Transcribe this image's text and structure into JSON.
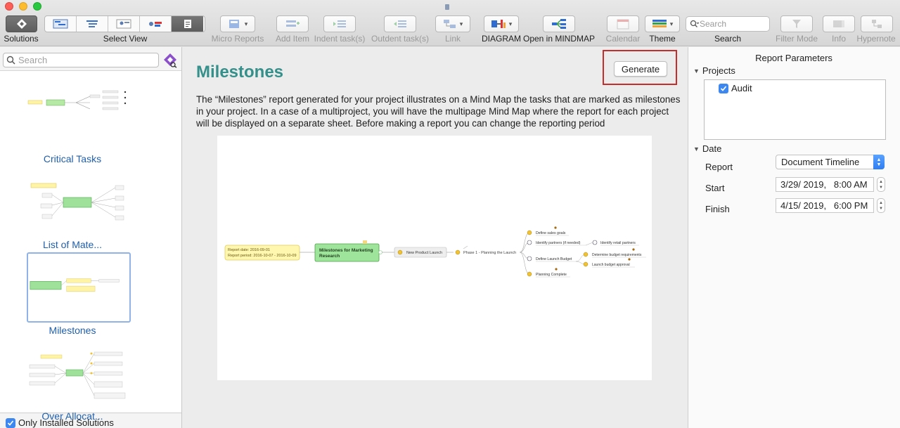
{
  "toolbar": {
    "solutions_label": "Solutions",
    "select_view_label": "Select View",
    "micro_reports_label": "Micro Reports",
    "add_item_label": "Add Item",
    "indent_label": "Indent task(s)",
    "outdent_label": "Outdent task(s)",
    "link_label": "Link",
    "diagram_label": "DIAGRAM",
    "open_mindmap_label": "Open in MINDMAP",
    "calendar_label": "Calendar",
    "theme_label": "Theme",
    "search_placeholder": "Search",
    "search_label": "Search",
    "filter_label": "Filter Mode",
    "info_label": "Info",
    "hypernote_label": "Hypernote"
  },
  "sidebar": {
    "search_placeholder": "Search",
    "solutions": [
      {
        "label": "Critical Tasks"
      },
      {
        "label": "List of Mate..."
      },
      {
        "label": "Milestones"
      },
      {
        "label": "Over Allocat..."
      }
    ],
    "only_installed_label": "Only Installed Solutions"
  },
  "main": {
    "title": "Milestones",
    "generate_label": "Generate",
    "description": "The “Milestones” report generated for your project illustrates on a Mind Map the tasks that are marked as milestones in your project. In a case of a multiproject, you will have the multipage Mind Map where the report for each project will be displayed on a separate sheet. Before making a report you can change the reporting period",
    "preview": {
      "report_date": "Report date: 2016-09-01",
      "report_period": "Report period: 2016-10-07 - 2016-10-09",
      "central_1": "Milestones for Marketing",
      "central_2": "Research",
      "launch": "New Product Launch",
      "phase": "Phase 1 - Planning the Launch",
      "t1": "Define sales goals",
      "t2": "Identify partners (if needed)",
      "t3": "Identify retail partners",
      "t4": "Define Launch Budget",
      "t5": "Determine budget requirements",
      "t6": "Launch budget approval",
      "t7": "Planning Complete"
    }
  },
  "rpanel": {
    "title": "Report Parameters",
    "projects_label": "Projects",
    "project_item": "Audit",
    "date_label": "Date",
    "report_label": "Report",
    "report_value": "Document Timeline",
    "start_label": "Start",
    "start_value": "3/29/ 2019,   8:00 AM",
    "finish_label": "Finish",
    "finish_value": "4/15/ 2019,   6:00 PM"
  },
  "colors": {
    "title_teal": "#34908a",
    "highlight_red": "#c62d2d",
    "checkbox_blue": "#3c87f0",
    "link_blue": "#1f5fad"
  }
}
